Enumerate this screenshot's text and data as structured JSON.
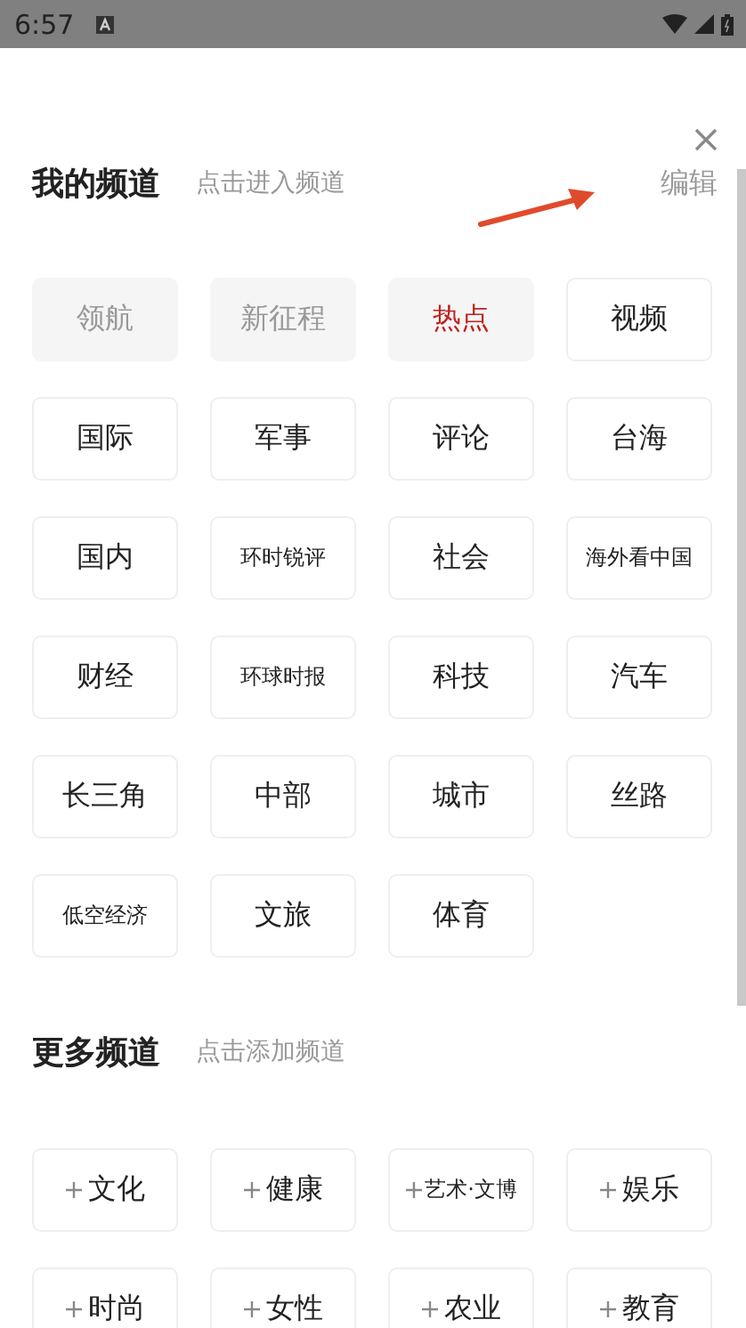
{
  "status_bar": {
    "time": "6:57"
  },
  "my_channels": {
    "title": "我的频道",
    "hint": "点击进入频道",
    "edit": "编辑",
    "items": [
      {
        "label": "领航",
        "fixed": true,
        "selected": false
      },
      {
        "label": "新征程",
        "fixed": true,
        "selected": false
      },
      {
        "label": "热点",
        "fixed": false,
        "selected": true
      },
      {
        "label": "视频",
        "fixed": false,
        "selected": false
      },
      {
        "label": "国际",
        "fixed": false,
        "selected": false
      },
      {
        "label": "军事",
        "fixed": false,
        "selected": false
      },
      {
        "label": "评论",
        "fixed": false,
        "selected": false
      },
      {
        "label": "台海",
        "fixed": false,
        "selected": false
      },
      {
        "label": "国内",
        "fixed": false,
        "selected": false
      },
      {
        "label": "环时锐评",
        "fixed": false,
        "selected": false
      },
      {
        "label": "社会",
        "fixed": false,
        "selected": false
      },
      {
        "label": "海外看中国",
        "fixed": false,
        "selected": false
      },
      {
        "label": "财经",
        "fixed": false,
        "selected": false
      },
      {
        "label": "环球时报",
        "fixed": false,
        "selected": false
      },
      {
        "label": "科技",
        "fixed": false,
        "selected": false
      },
      {
        "label": "汽车",
        "fixed": false,
        "selected": false
      },
      {
        "label": "长三角",
        "fixed": false,
        "selected": false
      },
      {
        "label": "中部",
        "fixed": false,
        "selected": false
      },
      {
        "label": "城市",
        "fixed": false,
        "selected": false
      },
      {
        "label": "丝路",
        "fixed": false,
        "selected": false
      },
      {
        "label": "低空经济",
        "fixed": false,
        "selected": false
      },
      {
        "label": "文旅",
        "fixed": false,
        "selected": false
      },
      {
        "label": "体育",
        "fixed": false,
        "selected": false
      }
    ]
  },
  "more_channels": {
    "title": "更多频道",
    "hint": "点击添加频道",
    "items": [
      {
        "label": "文化"
      },
      {
        "label": "健康"
      },
      {
        "label": "艺术·文博"
      },
      {
        "label": "娱乐"
      },
      {
        "label": "时尚"
      },
      {
        "label": "女性"
      },
      {
        "label": "农业"
      },
      {
        "label": "教育"
      }
    ]
  }
}
